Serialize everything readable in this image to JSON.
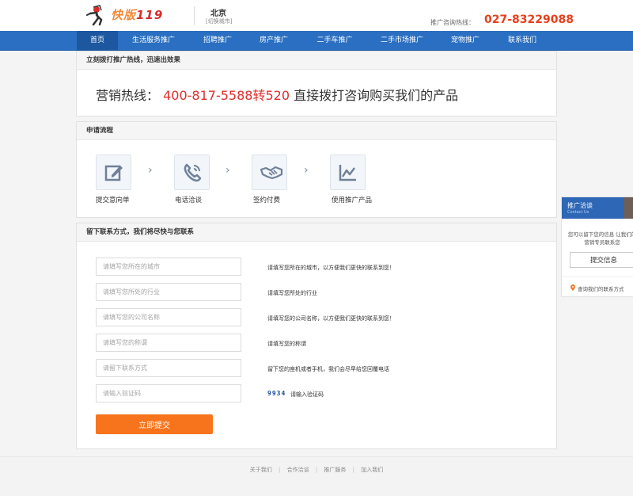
{
  "header": {
    "logo_text_cn": "快版",
    "logo_text_num": "119",
    "city": "北京",
    "city_switch": "[切换城市]",
    "hotline_label": "推广咨询热线：",
    "hotline_number": "027-83229088"
  },
  "nav": {
    "items": [
      {
        "label": "首页"
      },
      {
        "label": "生活服务推广"
      },
      {
        "label": "招聘推广"
      },
      {
        "label": "房产推广"
      },
      {
        "label": "二手车推广"
      },
      {
        "label": "二手市场推广"
      },
      {
        "label": "宠物推广"
      },
      {
        "label": "联系我们"
      }
    ]
  },
  "hotline_panel": {
    "title": "立刻拨打推广热线，迅速出效果",
    "label": "营销热线：",
    "number": "400-817-5588转520",
    "suffix": "直接拨打咨询购买我们的产品"
  },
  "process_panel": {
    "title": "申请流程",
    "steps": [
      {
        "label": "提交意向单",
        "icon": "edit-icon"
      },
      {
        "label": "电话洽谈",
        "icon": "phone-icon"
      },
      {
        "label": "签约付费",
        "icon": "handshake-icon"
      },
      {
        "label": "使用推广产品",
        "icon": "chart-icon"
      }
    ],
    "arrow": "›"
  },
  "contact_panel": {
    "title": "留下联系方式，我们将尽快与您联系",
    "fields": [
      {
        "placeholder": "请填写您所在的城市",
        "hint": "请填写您所在的城市，以方便我们更快的联系到您！"
      },
      {
        "placeholder": "请填写您所处的行业",
        "hint": "请填写您所处的行业"
      },
      {
        "placeholder": "请填写您的公司名称",
        "hint": "请填写您的公司名称，以方便我们更快的联系到您！"
      },
      {
        "placeholder": "请填写您的称谓",
        "hint": "请填写您的称谓"
      },
      {
        "placeholder": "请留下联系方式",
        "hint": "留下您的座机或者手机，我们会尽早给您回覆电话"
      },
      {
        "placeholder": "请输入验证码",
        "hint": "请输入验证码"
      }
    ],
    "captcha": "9934",
    "submit_label": "立即提交"
  },
  "sidebar": {
    "title": "推广洽谈",
    "subtitle": "Contact Us",
    "text": "您可以留下您的信息 让我们的营销专员联系您",
    "button_label": "提交信息",
    "link": "查询我们的联系方式"
  },
  "footer": {
    "links": [
      "关于我们",
      "合作洽谈",
      "推广服务",
      "加入我们"
    ],
    "separator": "|"
  },
  "colors": {
    "nav_bg": "#2a6fc1",
    "accent_red": "#e02d2d",
    "submit_orange": "#f7741c"
  }
}
